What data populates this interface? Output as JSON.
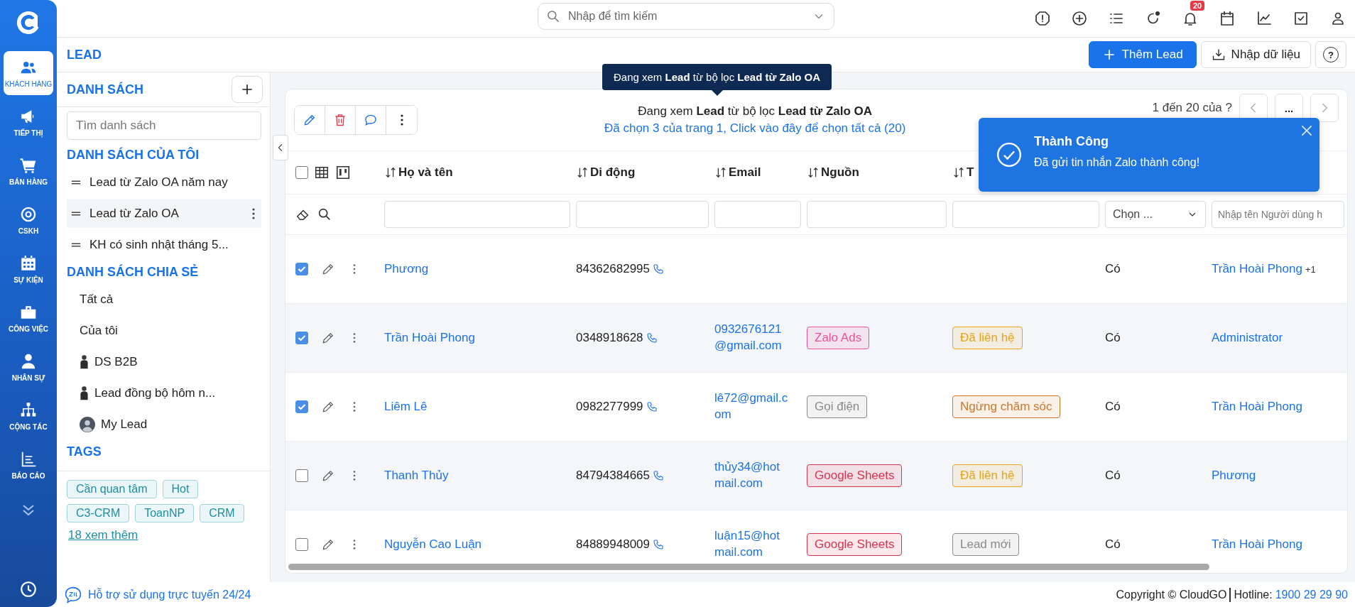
{
  "nav": {
    "items": [
      {
        "label": "KHÁCH HÀNG",
        "selected": true
      },
      {
        "label": "TIẾP THỊ",
        "selected": false
      },
      {
        "label": "BÁN HÀNG",
        "selected": false
      },
      {
        "label": "CSKH",
        "selected": false
      },
      {
        "label": "SỰ KIỆN",
        "selected": false
      },
      {
        "label": "CÔNG VIỆC",
        "selected": false
      },
      {
        "label": "NHÂN SỰ",
        "selected": false
      },
      {
        "label": "CỘNG TÁC",
        "selected": false
      },
      {
        "label": "BÁO CÁO",
        "selected": false
      }
    ]
  },
  "search": {
    "placeholder": "Nhập để tìm kiếm"
  },
  "notifications": {
    "badge": "20"
  },
  "page": {
    "title": "LEAD",
    "add_button": "Thêm Lead",
    "import_button": "Nhập dữ liệu",
    "help_button": "?"
  },
  "lists": {
    "title": "DANH SÁCH",
    "search_placeholder": "Tìm danh sách",
    "my_title": "DANH SÁCH CỦA TÔI",
    "my_items": [
      {
        "label": "Lead từ Zalo OA năm nay",
        "selected": false
      },
      {
        "label": "Lead từ Zalo OA",
        "selected": true
      },
      {
        "label": "KH có sinh nhật tháng 5...",
        "selected": false
      }
    ],
    "shared_title": "DANH SÁCH CHIA SẺ",
    "shared_items": [
      {
        "label": "Tất cả",
        "kind": "plain"
      },
      {
        "label": "Của tôi",
        "kind": "plain"
      },
      {
        "label": "DS B2B",
        "kind": "figure"
      },
      {
        "label": "Lead đồng bộ hôm n...",
        "kind": "figure"
      },
      {
        "label": "My Lead",
        "kind": "avatar"
      }
    ],
    "tags_title": "TAGS",
    "tags": [
      "Cần quan tâm",
      "Hot",
      "C3-CRM",
      "ToanNP",
      "CRM"
    ],
    "more_link": "18 xem thêm"
  },
  "tooltip": "Đang xem **Lead** từ bộ lọc **Lead từ Zalo OA**",
  "table": {
    "info": "Đang xem **Lead** từ bộ lọc **Lead từ Zalo OA**",
    "select_all_link": "Đã chọn 3 của trang 1, Click vào đây để chọn tất cả (20)",
    "pagination": "1 đến 20 của ?",
    "more_button": "...",
    "select_all_checked": false,
    "columns": [
      "Họ và tên",
      "Di động",
      "Email",
      "Nguồn",
      "T"
    ],
    "status_filter_placeholder": "Chọn ...",
    "user_filter_placeholder": "Nhập tên Người dùng h",
    "rows": [
      {
        "checked": true,
        "name": "Phương",
        "phone": "84362682995",
        "email": "",
        "source": null,
        "status": null,
        "col6": "Có",
        "owner": "Trần Hoài Phong",
        "extra": "+1"
      },
      {
        "checked": true,
        "name": "Trần Hoài Phong",
        "phone": "0348918628",
        "email": "0932676121@gmail.com",
        "source": {
          "label": "Zalo Ads",
          "color": "#e8559a"
        },
        "status": {
          "label": "Đã liên hệ",
          "color": "#e8a317"
        },
        "col6": "Có",
        "owner": "Administrator",
        "extra": ""
      },
      {
        "checked": true,
        "name": "Liêm Lê",
        "phone": "0982277999",
        "email": "lê72@gmail.com",
        "source": {
          "label": "Gọi điện",
          "color": "#8a8a8a"
        },
        "status": {
          "label": "Ngừng chăm sóc",
          "color": "#c9782e"
        },
        "col6": "Có",
        "owner": "Trần Hoài Phong",
        "extra": ""
      },
      {
        "checked": false,
        "name": "Thanh Thủy",
        "phone": "84794384665",
        "email": "thủy34@hotmail.com",
        "source": {
          "label": "Google Sheets",
          "color": "#d9344f"
        },
        "status": {
          "label": "Đã liên hệ",
          "color": "#e8a317"
        },
        "col6": "Có",
        "owner": "Phương",
        "extra": ""
      },
      {
        "checked": false,
        "name": "Nguyễn Cao Luận",
        "phone": "84889948009",
        "email": "luận15@hotmail.com",
        "source": {
          "label": "Google Sheets",
          "color": "#d9344f"
        },
        "status": {
          "label": "Lead mới",
          "color": "#8a8a8a"
        },
        "col6": "Có",
        "owner": "Trần Hoài Phong",
        "extra": ""
      }
    ]
  },
  "toast": {
    "title": "Thành Công",
    "message": "Đã gửi tin nhắn Zalo thành công!"
  },
  "footer": {
    "support": "Hỗ trợ sử dụng trực tuyến 24/24",
    "copyright": "Copyright © CloudGO",
    "hotline_label": "Hotline:",
    "hotline": "1900 29 29 90"
  }
}
